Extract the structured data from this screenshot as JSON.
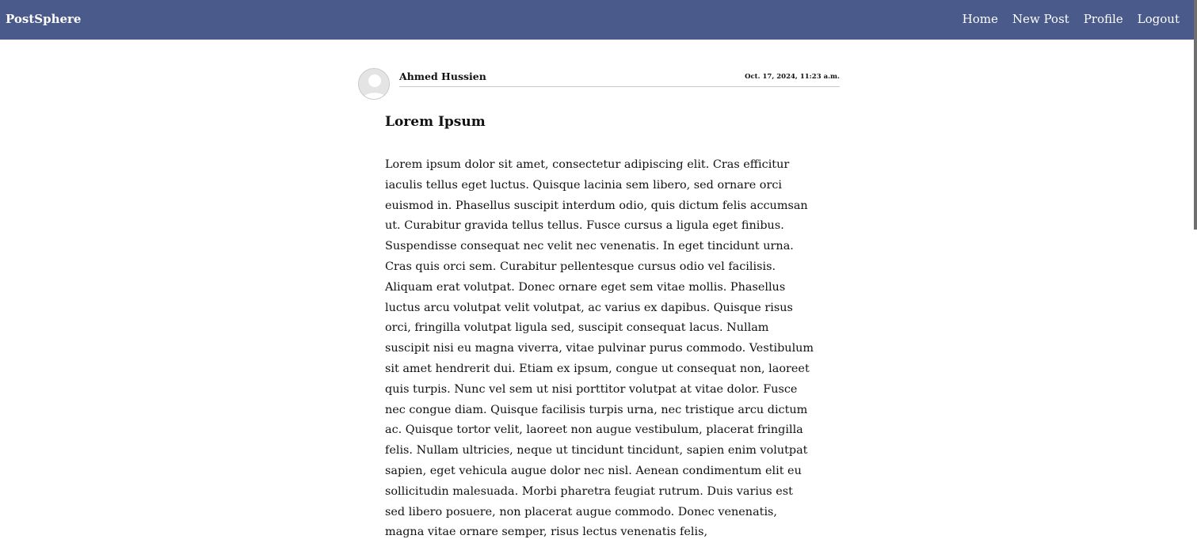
{
  "nav": {
    "brand": "PostSphere",
    "links": [
      "Home",
      "New Post",
      "Profile",
      "Logout"
    ]
  },
  "post": {
    "author": "Ahmed Hussien",
    "date": "Oct. 17, 2024, 11:23 a.m.",
    "title": "Lorem Ipsum",
    "body": "Lorem ipsum dolor sit amet, consectetur adipiscing elit. Cras efficitur iaculis tellus eget luctus. Quisque lacinia sem libero, sed ornare orci euismod in. Phasellus suscipit interdum odio, quis dictum felis accumsan ut. Curabitur gravida tellus tellus. Fusce cursus a ligula eget finibus. Suspendisse consequat nec velit nec venenatis. In eget tincidunt urna. Cras quis orci sem. Curabitur pellentesque cursus odio vel facilisis. Aliquam erat volutpat. Donec ornare eget sem vitae mollis. Phasellus luctus arcu volutpat velit volutpat, ac varius ex dapibus. Quisque risus orci, fringilla volutpat ligula sed, suscipit consequat lacus. Nullam suscipit nisi eu magna viverra, vitae pulvinar purus commodo. Vestibulum sit amet hendrerit dui. Etiam ex ipsum, congue ut consequat non, laoreet quis turpis. Nunc vel sem ut nisi porttitor volutpat at vitae dolor. Fusce nec congue diam. Quisque facilisis turpis urna, nec tristique arcu dictum ac. Quisque tortor velit, laoreet non augue vestibulum, placerat fringilla felis. Nullam ultricies, neque ut tincidunt tincidunt, sapien enim volutpat sapien, eget vehicula augue dolor nec nisl. Aenean condimentum elit eu sollicitudin malesuada. Morbi pharetra feugiat rutrum. Duis varius est sed libero posuere, non placerat augue commodo. Donec venenatis, magna vitae ornare semper, risus lectus venenatis felis,"
  },
  "icons": {
    "avatar": "user-placeholder-icon"
  },
  "colors": {
    "navbar": "#4a5a8a",
    "nav_text": "#ffffff",
    "divider": "#c8c8c8"
  }
}
